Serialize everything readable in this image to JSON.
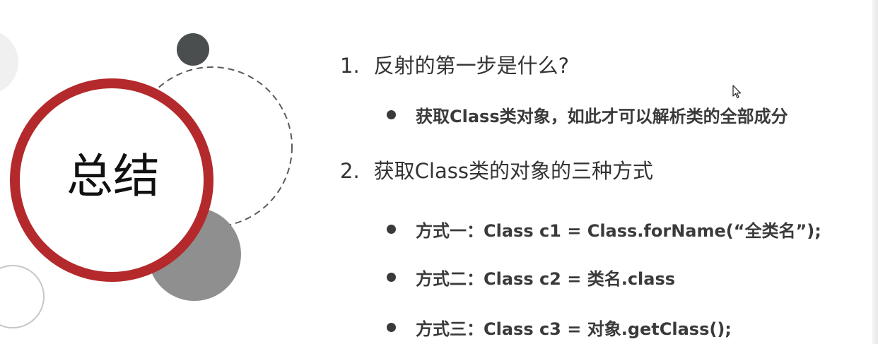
{
  "slide": {
    "title": "总结",
    "questions": [
      {
        "number": "1.",
        "text": "反射的第一步是什么?",
        "bullets": [
          "获取Class类对象，如此才可以解析类的全部成分"
        ]
      },
      {
        "number": "2.",
        "text": "获取Class类的对象的三种方式",
        "bullets": [
          "方式一：Class c1 = Class.forName(“全类名”);",
          "方式二：Class c2 = 类名.class",
          "方式三：Class c3 = 对象.getClass();"
        ]
      }
    ]
  },
  "colors": {
    "ring": "#b4292b",
    "dark_circle": "#4a4e4e",
    "gray_circle": "#8f8f8f",
    "text": "#333333"
  },
  "icons": [
    "bullet-dot-icon",
    "mouse-cursor-icon"
  ]
}
